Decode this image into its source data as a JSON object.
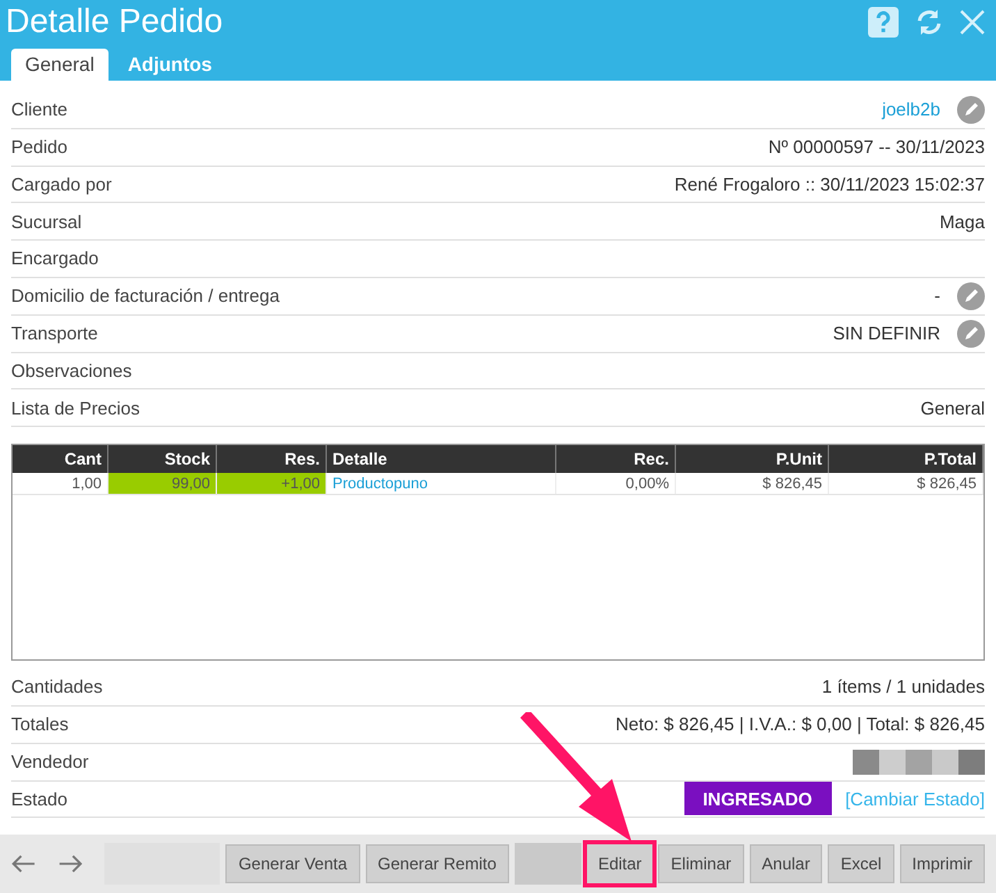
{
  "window": {
    "title": "Detalle Pedido"
  },
  "tabs": [
    {
      "label": "General",
      "selected": true
    },
    {
      "label": "Adjuntos",
      "selected": false
    }
  ],
  "fields": [
    {
      "label": "Cliente",
      "value": "joelb2b",
      "kind": "link",
      "editable": true
    },
    {
      "label": "Pedido",
      "value": "Nº 00000597 -- 30/11/2023",
      "kind": "text",
      "editable": false
    },
    {
      "label": "Cargado por",
      "value": "René Frogaloro :: 30/11/2023 15:02:37",
      "kind": "text",
      "editable": false
    },
    {
      "label": "Sucursal",
      "value": "Maga",
      "kind": "text",
      "editable": false
    },
    {
      "label": "Encargado",
      "editable": false
    },
    {
      "label": "Domicilio de facturación / entrega",
      "value": "-",
      "kind": "text",
      "editable": true
    },
    {
      "label": "Transporte",
      "value": "SIN DEFINIR",
      "kind": "text",
      "editable": true
    },
    {
      "label": "Observaciones",
      "editable": false
    },
    {
      "label": "Lista de Precios",
      "value": "General",
      "kind": "text",
      "editable": false
    }
  ],
  "table": {
    "columns": [
      "Cant",
      "Stock",
      "Res.",
      "Detalle",
      "Rec.",
      "P.Unit",
      "P.Total"
    ],
    "rows": [
      {
        "cells": [
          "1,00",
          "99,00",
          "+1,00",
          "Productopuno",
          "0,00%",
          "$ 826,45",
          "$ 826,45"
        ],
        "stock_ok": true
      }
    ]
  },
  "summary": [
    {
      "label": "Cantidades",
      "value": "1 ítems / 1 unidades",
      "kind": "text"
    },
    {
      "label": "Totales",
      "value": "Neto: $ 826,45 | I.V.A.: $ 0,00 | Total: $ 826,45",
      "kind": "text"
    },
    {
      "label": "Vendedor",
      "kind": "redacted"
    },
    {
      "label": "Estado",
      "kind": "status",
      "status": "INGRESADO",
      "color": "#7a0fc0",
      "action": "[Cambiar Estado]"
    }
  ],
  "footer_buttons": [
    {
      "kind": "redacted"
    },
    {
      "kind": "button",
      "label": "Generar Venta",
      "highlighted": false
    },
    {
      "kind": "button",
      "label": "Generar Remito",
      "highlighted": false
    },
    {
      "kind": "redacted"
    },
    {
      "kind": "button",
      "label": "Editar",
      "highlighted": true
    },
    {
      "kind": "button",
      "label": "Eliminar",
      "highlighted": false
    },
    {
      "kind": "button",
      "label": "Anular",
      "highlighted": false
    },
    {
      "kind": "button",
      "label": "Excel",
      "highlighted": false
    },
    {
      "kind": "button",
      "label": "Imprimir",
      "highlighted": false
    }
  ]
}
